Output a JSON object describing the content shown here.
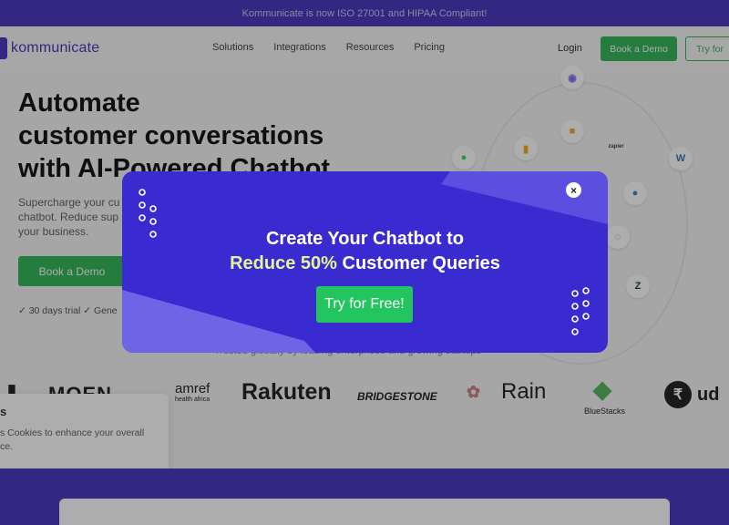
{
  "banner": {
    "text": "Kommunicate is now ISO 27001 and HIPAA Compliant!"
  },
  "nav": {
    "logo": "kommunicate",
    "links": [
      "Solutions",
      "Integrations",
      "Resources",
      "Pricing"
    ],
    "login": "Login",
    "book_demo": "Book a Demo",
    "try_free": "Try for"
  },
  "hero": {
    "title_line1": "Automate",
    "title_line2": "customer conversations",
    "title_line3": "with AI-Powered Chatbot",
    "subtitle_line1": "Supercharge your cu",
    "subtitle_line2": "chatbot. Reduce sup",
    "subtitle_line3": "your business.",
    "book_demo": "Book a Demo",
    "trial_note": "✓ 30 days trial  ✓ Gene"
  },
  "integrations": [
    {
      "name": "messenger-icon",
      "glyph": "◉",
      "color": "#7b5cf5"
    },
    {
      "name": "amazon-icon",
      "glyph": "■",
      "color": "#f0a020"
    },
    {
      "name": "analytics-icon",
      "glyph": "▮",
      "color": "#f2a900"
    },
    {
      "name": "zapier-icon",
      "glyph": "zapier",
      "color": "#333333"
    },
    {
      "name": "whatsapp-icon",
      "glyph": "●",
      "color": "#25d366"
    },
    {
      "name": "wordpress-icon",
      "glyph": "W",
      "color": "#21759b"
    },
    {
      "name": "helpdesk-icon",
      "glyph": "●",
      "color": "#3a6fd0"
    },
    {
      "name": "support-icon",
      "glyph": "◌",
      "color": "#3aa0d8"
    },
    {
      "name": "zendesk-icon",
      "glyph": "Z",
      "color": "#03363d"
    }
  ],
  "trusted": {
    "text": "Trusted globally by leading enterprises and growing startups"
  },
  "brands": [
    {
      "name": "brand-moen",
      "label": "MOEN",
      "color": "#1f3d8f"
    },
    {
      "name": "brand-amref",
      "label": "amref",
      "color": "#333333"
    },
    {
      "name": "brand-amref-sub",
      "label": "health africa",
      "color": "#c9343a"
    },
    {
      "name": "brand-rakuten",
      "label": "Rakuten",
      "color": "#bf0000"
    },
    {
      "name": "brand-bridgestone",
      "label": "BRIDGESTONE",
      "color": "#222222"
    },
    {
      "name": "brand-rain",
      "label": "Rain",
      "color": "#333333"
    },
    {
      "name": "brand-bluestacks",
      "label": "BlueStacks",
      "color": "#6a6a6a"
    },
    {
      "name": "brand-ud",
      "label": "ud",
      "color": "#111111"
    }
  ],
  "cookie": {
    "title": "s",
    "text_line1": "s Cookies to enhance your overall",
    "text_line2": "ce."
  },
  "modal": {
    "title_line1": "Create Your Chatbot to",
    "highlight": "Reduce 50%",
    "title_rest": " Customer Queries",
    "cta": "Try for Free!",
    "close": "×"
  }
}
